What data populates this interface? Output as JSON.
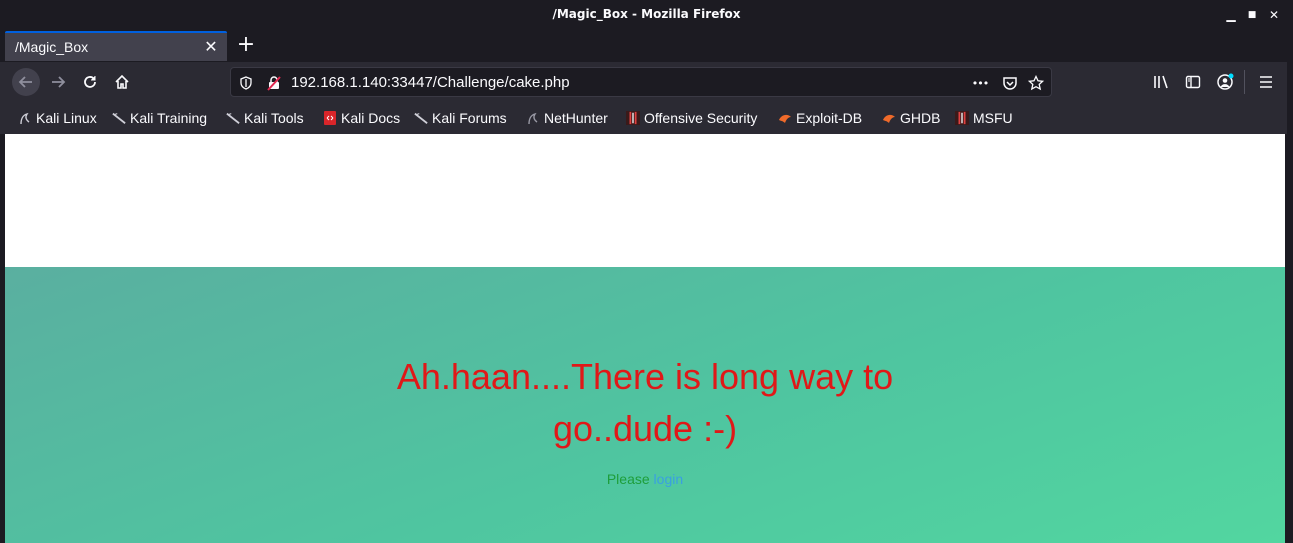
{
  "window": {
    "title": "/Magic_Box - Mozilla Firefox",
    "controls": {
      "minimize": "▁",
      "maximize": "■",
      "close": "✕"
    }
  },
  "tabs": [
    {
      "label": "/Magic_Box",
      "active": true
    }
  ],
  "tabbar": {
    "close_glyph": "✕",
    "new_tab_glyph": "+"
  },
  "navbar": {
    "url": "192.168.1.140:33447/Challenge/cake.php",
    "more_glyph": "•••"
  },
  "bookmarks": [
    {
      "label": "Kali Linux",
      "icon": "kali-dragon-icon"
    },
    {
      "label": "Kali Training",
      "icon": "kali-dragon-icon"
    },
    {
      "label": "Kali Tools",
      "icon": "kali-dragon-icon"
    },
    {
      "label": "Kali Docs",
      "icon": "kali-docs-icon"
    },
    {
      "label": "Kali Forums",
      "icon": "kali-dragon-icon"
    },
    {
      "label": "NetHunter",
      "icon": "nethunter-icon"
    },
    {
      "label": "Offensive Security",
      "icon": "offsec-icon"
    },
    {
      "label": "Exploit-DB",
      "icon": "exploitdb-icon"
    },
    {
      "label": "GHDB",
      "icon": "ghdb-icon"
    },
    {
      "label": "MSFU",
      "icon": "offsec-icon"
    }
  ],
  "page": {
    "headline": "Ah.haan....There is long way to go..dude :-)",
    "please_text": "Please",
    "login_link": "login"
  },
  "colors": {
    "headline": "#e01818",
    "please": "#1e9e3a",
    "link": "#3aa0e0",
    "hero_start": "#5aafa0",
    "hero_end": "#52d6a0"
  }
}
